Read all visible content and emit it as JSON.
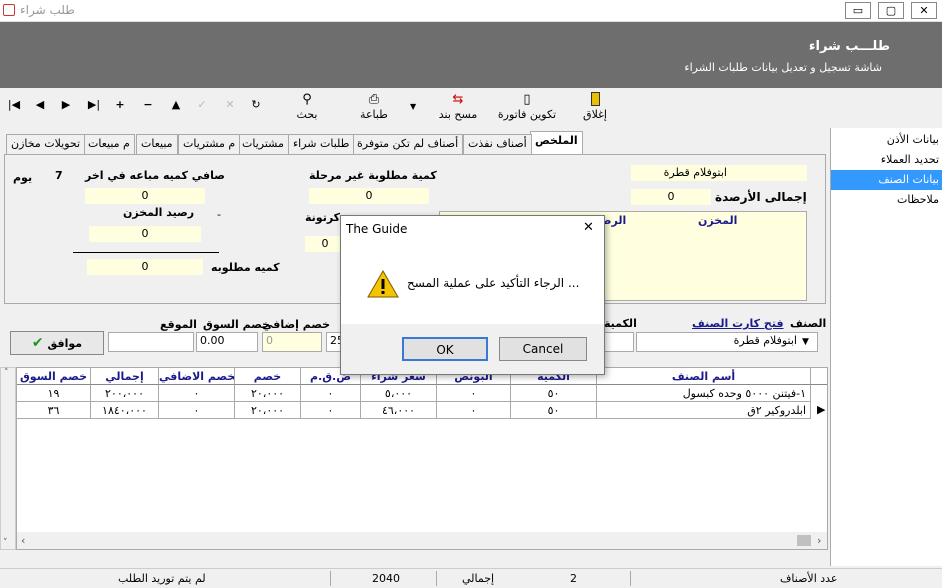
{
  "window": {
    "title": "طلب شراء",
    "minimize": "▭",
    "restore": "▢",
    "close": "✕"
  },
  "header": {
    "title": "طلـــب شراء",
    "subtitle": "شاشة تسجيل  و  تعديل بيانات طلبات الشراء"
  },
  "toolbar": {
    "close_label": "إغلاق",
    "invoice_label": "تكوين فاتورة",
    "delete_item_label": "مسح بند",
    "print_label": "طباعة",
    "search_label": "بحث",
    "dropdown_arrow": "▼"
  },
  "nav": {
    "first": "|◀",
    "prev": "◀",
    "next": "▶",
    "last": "▶|",
    "add": "+",
    "remove": "−",
    "up": "▲",
    "check": "✓",
    "cancel": "✕",
    "refresh": "↻"
  },
  "tabs": [
    "الملخص",
    "أصناف نفذت",
    "أصناف لم تكن متوفرة",
    "طلبات شراء",
    "مشتريات",
    "م مشتريات",
    "مبيعات",
    "م مبيعات",
    "تحويلات مخازن"
  ],
  "side_items": [
    "بيانات الأذن",
    "تحديد العملاء",
    "بيانات الصنف",
    "ملاحظات"
  ],
  "summary": {
    "item_name": "ابتوفلام قطرة",
    "total_balance_label": "إجمالى الأرصدة",
    "total_balance_value": "0",
    "unstaged_qty_label": "كمية مطلوبة غير مرحلة",
    "unstaged_qty_value": "0",
    "net_sold_label": "صافي كميه مباعه في اخر",
    "net_sold_days": "7",
    "net_sold_unit": "يوم",
    "net_sold_value": "0",
    "store_balance_label": "رصيد المخزن",
    "store_balance_dash": "-",
    "store_balance_value": "0",
    "required_qty_label": "كميه مطلوبه",
    "required_qty_value": "0",
    "carton_label": "كرتونة",
    "carton_value": "0",
    "stores_col_store": "المخزن",
    "stores_col_balance": "الرصيد"
  },
  "entry": {
    "item_label": "الصنف",
    "item_value": "ابتوفلام قطرة",
    "open_card_link": "فتح كارت الصنف",
    "qty_label": "الكمية",
    "extra_discount_label": "خصم إضافي",
    "market_discount_label": "خصم السوق",
    "location_label": "الموقع",
    "extra_discount_value": "0",
    "market_discount_value": "0.00",
    "qty_value": "25",
    "ok_label": "موافق"
  },
  "grid": {
    "columns": [
      "أسم الصنف",
      "الكمية",
      "البونص",
      "سعر شراء",
      "ض.ق.م",
      "خصم",
      "الخصم الاضافي",
      "إجمالي",
      "خصم السوق"
    ],
    "rows": [
      [
        "١-فيتنن ٥٠٠٠ وحده كبسول",
        "٥٠",
        "٠",
        "٥،٠٠٠",
        "٠",
        "٢٠،٠٠٠",
        "٠",
        "٢٠٠،٠٠٠",
        "١٩"
      ],
      [
        "ابلدروكير ٢ق",
        "٥٠",
        "٠",
        "٤٦،٠٠٠",
        "٠",
        "٢٠،٠٠٠",
        "٠",
        "١٨٤٠،٠٠٠",
        "٣٦"
      ]
    ]
  },
  "status": {
    "items_count_label": "عدد الأصناف",
    "items_count_value": "2",
    "total_label": "إجمالي",
    "total_value": "2040",
    "supply_status": "لم يتم توريد الطلب"
  },
  "dialog": {
    "title": "The Guide",
    "close": "✕",
    "message": "الرجاء التأكيد على عملية المسح ...",
    "ok_label": "OK",
    "cancel_label": "Cancel"
  }
}
